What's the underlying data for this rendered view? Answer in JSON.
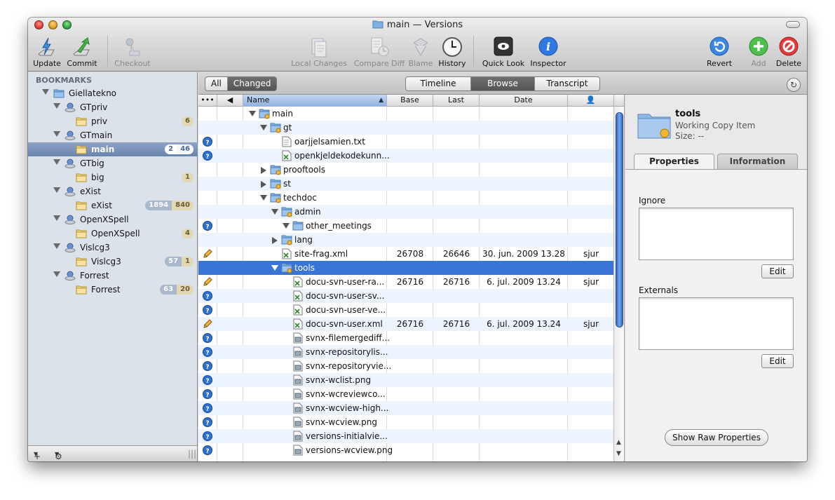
{
  "window": {
    "title": "main — Versions",
    "traffic_lights": {
      "close": "#e0443e",
      "minimize": "#dea123",
      "zoom": "#35a64a"
    }
  },
  "toolbar": {
    "update": "Update",
    "commit": "Commit",
    "checkout": "Checkout",
    "local_changes": "Local Changes",
    "compare_diff": "Compare Diff",
    "blame": "Blame",
    "history": "History",
    "quick_look": "Quick Look",
    "inspector": "Inspector",
    "revert": "Revert",
    "add": "Add",
    "delete": "Delete"
  },
  "sidebar": {
    "title": "BOOKMARKS",
    "items": [
      {
        "label": "Giellatekno",
        "type": "folder-group"
      },
      {
        "label": "GTpriv",
        "type": "repository"
      },
      {
        "label": "priv",
        "type": "working-copy",
        "badge_changed": "6"
      },
      {
        "label": "GTmain",
        "type": "repository"
      },
      {
        "label": "main",
        "type": "working-copy",
        "selected": true,
        "badge_count": "2",
        "badge_changed": "46"
      },
      {
        "label": "GTbig",
        "type": "repository"
      },
      {
        "label": "big",
        "type": "working-copy",
        "badge_changed": "1"
      },
      {
        "label": "eXist",
        "type": "repository"
      },
      {
        "label": "eXist",
        "type": "working-copy",
        "badge_count": "1894",
        "badge_changed": "840"
      },
      {
        "label": "OpenXSpell",
        "type": "repository"
      },
      {
        "label": "OpenXSpell",
        "type": "working-copy",
        "badge_changed": "4"
      },
      {
        "label": "Vislcg3",
        "type": "repository"
      },
      {
        "label": "Vislcg3",
        "type": "working-copy",
        "badge_count": "57",
        "badge_changed": "1"
      },
      {
        "label": "Forrest",
        "type": "repository"
      },
      {
        "label": "Forrest",
        "type": "working-copy",
        "badge_count": "63",
        "badge_changed": "20"
      }
    ],
    "bottom": {
      "add": "+",
      "action": "⚙"
    }
  },
  "filter": {
    "all": "All",
    "changed": "Changed",
    "selected": "Changed"
  },
  "view_modes": {
    "timeline": "Timeline",
    "browse": "Browse",
    "transcript": "Transcript",
    "selected": "Browse"
  },
  "columns": {
    "status": "•••",
    "tag": "",
    "name": "Name",
    "base": "Base",
    "last": "Last",
    "date": "Date",
    "author": "👤"
  },
  "files": [
    {
      "name": "main",
      "kind": "folder",
      "depth": 0,
      "disclosure": "open",
      "status": ""
    },
    {
      "name": "gt",
      "kind": "folder",
      "depth": 1,
      "disclosure": "open",
      "status": ""
    },
    {
      "name": "oarjjelsamien.txt",
      "kind": "text",
      "depth": 2,
      "disclosure": "",
      "status": "unversioned"
    },
    {
      "name": "openkjeldekodekunn...",
      "kind": "xml",
      "depth": 2,
      "disclosure": "",
      "status": "unversioned"
    },
    {
      "name": "prooftools",
      "kind": "folder",
      "depth": 1,
      "disclosure": "closed",
      "status": ""
    },
    {
      "name": "st",
      "kind": "folder",
      "depth": 1,
      "disclosure": "closed",
      "status": ""
    },
    {
      "name": "techdoc",
      "kind": "folder",
      "depth": 1,
      "disclosure": "open",
      "status": ""
    },
    {
      "name": "admin",
      "kind": "folder",
      "depth": 2,
      "disclosure": "open",
      "status": ""
    },
    {
      "name": "other_meetings",
      "kind": "folder-plain",
      "depth": 3,
      "disclosure": "open",
      "status": "unversioned"
    },
    {
      "name": "lang",
      "kind": "folder",
      "depth": 2,
      "disclosure": "closed",
      "status": ""
    },
    {
      "name": "site-frag.xml",
      "kind": "xml",
      "depth": 2,
      "disclosure": "",
      "status": "modified",
      "base": "26708",
      "last": "26646",
      "date": "30. jun. 2009 13.28",
      "author": "sjur"
    },
    {
      "name": "tools",
      "kind": "folder",
      "depth": 2,
      "disclosure": "open",
      "status": "",
      "selected": true
    },
    {
      "name": "docu-svn-user-ra...",
      "kind": "xml",
      "depth": 3,
      "disclosure": "",
      "status": "modified",
      "base": "26716",
      "last": "26716",
      "date": "6. jul. 2009 13.24",
      "author": "sjur"
    },
    {
      "name": "docu-svn-user-sv...",
      "kind": "xml",
      "depth": 3,
      "disclosure": "",
      "status": "unversioned"
    },
    {
      "name": "docu-svn-user-ve...",
      "kind": "xml",
      "depth": 3,
      "disclosure": "",
      "status": "unversioned"
    },
    {
      "name": "docu-svn-user.xml",
      "kind": "xml",
      "depth": 3,
      "disclosure": "",
      "status": "modified",
      "base": "26716",
      "last": "26716",
      "date": "6. jul. 2009 13.24",
      "author": "sjur"
    },
    {
      "name": "svnx-filemergediff...",
      "kind": "image",
      "depth": 3,
      "disclosure": "",
      "status": "unversioned"
    },
    {
      "name": "svnx-repositorylis...",
      "kind": "image",
      "depth": 3,
      "disclosure": "",
      "status": "unversioned"
    },
    {
      "name": "svnx-repositoryvie...",
      "kind": "image",
      "depth": 3,
      "disclosure": "",
      "status": "unversioned"
    },
    {
      "name": "svnx-wclist.png",
      "kind": "image",
      "depth": 3,
      "disclosure": "",
      "status": "unversioned"
    },
    {
      "name": "svnx-wcreviewco...",
      "kind": "image",
      "depth": 3,
      "disclosure": "",
      "status": "unversioned"
    },
    {
      "name": "svnx-wcview-high...",
      "kind": "image",
      "depth": 3,
      "disclosure": "",
      "status": "unversioned"
    },
    {
      "name": "svnx-wcview.png",
      "kind": "image",
      "depth": 3,
      "disclosure": "",
      "status": "unversioned"
    },
    {
      "name": "versions-initialvie...",
      "kind": "image",
      "depth": 3,
      "disclosure": "",
      "status": "unversioned"
    },
    {
      "name": "versions-wcview.png",
      "kind": "image",
      "depth": 3,
      "disclosure": "",
      "status": "unversioned"
    }
  ],
  "inspector": {
    "name": "tools",
    "kind": "Working Copy Item",
    "size": "Size: --",
    "tabs": {
      "properties": "Properties",
      "information": "Information",
      "selected": "Properties"
    },
    "ignore_label": "Ignore",
    "externals_label": "Externals",
    "edit": "Edit",
    "show_raw": "Show Raw Properties"
  }
}
